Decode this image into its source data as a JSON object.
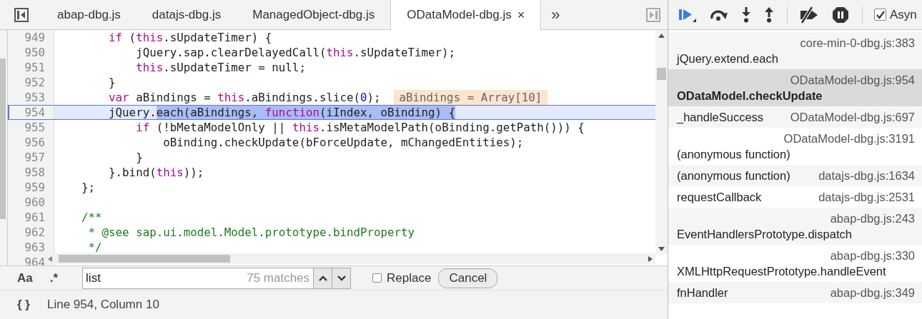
{
  "tabs": [
    {
      "label": "abap-dbg.js",
      "selected": false
    },
    {
      "label": "datajs-dbg.js",
      "selected": false
    },
    {
      "label": "ManagedObject-dbg.js",
      "selected": false
    },
    {
      "label": "ODataModel-dbg.js",
      "selected": true,
      "close": "×"
    }
  ],
  "more_tabs": "»",
  "code_lines": [
    {
      "number": "949",
      "current": false,
      "segments": [
        {
          "text": "        if",
          "kind": "keyword"
        },
        {
          "text": " (",
          "kind": "plain"
        },
        {
          "text": "this",
          "kind": "keyword"
        },
        {
          "text": ".sUpdateTimer) {",
          "kind": "plain"
        }
      ]
    },
    {
      "number": "950",
      "current": false,
      "segments": [
        {
          "text": "            jQuery.sap.clearDelayedCall(",
          "kind": "plain"
        },
        {
          "text": "this",
          "kind": "keyword"
        },
        {
          "text": ".sUpdateTimer);",
          "kind": "plain"
        }
      ]
    },
    {
      "number": "951",
      "current": false,
      "segments": [
        {
          "text": "            this",
          "kind": "keyword"
        },
        {
          "text": ".sUpdateTimer = null;",
          "kind": "plain"
        }
      ]
    },
    {
      "number": "952",
      "current": false,
      "segments": [
        {
          "text": "        }",
          "kind": "plain"
        }
      ]
    },
    {
      "number": "953",
      "current": false,
      "segments": [
        {
          "text": "        var",
          "kind": "keyword"
        },
        {
          "text": " aBindings = ",
          "kind": "plain"
        },
        {
          "text": "this",
          "kind": "keyword"
        },
        {
          "text": ".aBindings.slice(",
          "kind": "plain"
        },
        {
          "text": "0",
          "kind": "number"
        },
        {
          "text": ");",
          "kind": "plain"
        }
      ],
      "inline_value": "aBindings = Array[10]"
    },
    {
      "number": "954",
      "current": true,
      "segments": [
        {
          "text": "        jQuery.",
          "kind": "plain"
        },
        {
          "text": "each(aBindings, ",
          "kind": "match"
        },
        {
          "text": "function",
          "kind": "match-keyword"
        },
        {
          "text": "(iIndex, oBinding) {",
          "kind": "match"
        }
      ]
    },
    {
      "number": "955",
      "current": false,
      "segments": [
        {
          "text": "            if",
          "kind": "keyword"
        },
        {
          "text": " (!bMetaModelOnly || ",
          "kind": "plain"
        },
        {
          "text": "this",
          "kind": "keyword"
        },
        {
          "text": ".isMetaModelPath(oBinding.getPath())) {",
          "kind": "plain"
        }
      ]
    },
    {
      "number": "956",
      "current": false,
      "segments": [
        {
          "text": "                oBinding.checkUpdate(bForceUpdate, mChangedEntities);",
          "kind": "plain"
        }
      ]
    },
    {
      "number": "957",
      "current": false,
      "segments": [
        {
          "text": "            }",
          "kind": "plain"
        }
      ]
    },
    {
      "number": "958",
      "current": false,
      "segments": [
        {
          "text": "        }.bind(",
          "kind": "plain"
        },
        {
          "text": "this",
          "kind": "keyword"
        },
        {
          "text": "));",
          "kind": "plain"
        }
      ]
    },
    {
      "number": "959",
      "current": false,
      "segments": [
        {
          "text": "    };",
          "kind": "plain"
        }
      ]
    },
    {
      "number": "960",
      "current": false
    },
    {
      "number": "961",
      "current": false,
      "segments": [
        {
          "text": "    /**",
          "kind": "comment"
        }
      ]
    },
    {
      "number": "962",
      "current": false,
      "segments": [
        {
          "text": "     * @see sap.ui.model.Model.prototype.bindProperty",
          "kind": "comment"
        }
      ]
    },
    {
      "number": "963",
      "current": false,
      "segments": [
        {
          "text": "     */",
          "kind": "comment"
        }
      ]
    },
    {
      "number": "964",
      "current": false
    }
  ],
  "search_bar": {
    "case_toggle": "Aa",
    "regex_toggle": ".*",
    "value": "list",
    "matches": "75 matches",
    "replace": {
      "label": "Replace",
      "checked": false
    },
    "cancel": "Cancel"
  },
  "status_bar": {
    "pretty_print": "{ }",
    "position": "Line 954, Column 10"
  },
  "debugger_toolbar": {
    "async": {
      "label": "Asyn",
      "checked": true
    }
  },
  "call_stack": [
    {
      "name": "jQuery.extend.each",
      "location": "core-min-0-dbg.js:383",
      "selected": false
    },
    {
      "name": "ODataModel.checkUpdate",
      "location": "ODataModel-dbg.js:954",
      "selected": true
    },
    {
      "name": "_handleSuccess",
      "location": "ODataModel-dbg.js:697",
      "selected": false
    },
    {
      "name": "(anonymous function)",
      "location": "ODataModel-dbg.js:3191",
      "selected": false
    },
    {
      "name": "(anonymous function)",
      "location": "datajs-dbg.js:1634",
      "selected": false
    },
    {
      "name": "requestCallback",
      "location": "datajs-dbg.js:2531",
      "selected": false
    },
    {
      "name": "EventHandlersPrototype.dispatch",
      "location": "abap-dbg.js:243",
      "selected": false
    },
    {
      "name": "XMLHttpRequestPrototype.handleEvent",
      "location": "abap-dbg.js:330",
      "selected": false
    },
    {
      "name": "fnHandler",
      "location": "abap-dbg.js:349",
      "selected": false
    }
  ]
}
